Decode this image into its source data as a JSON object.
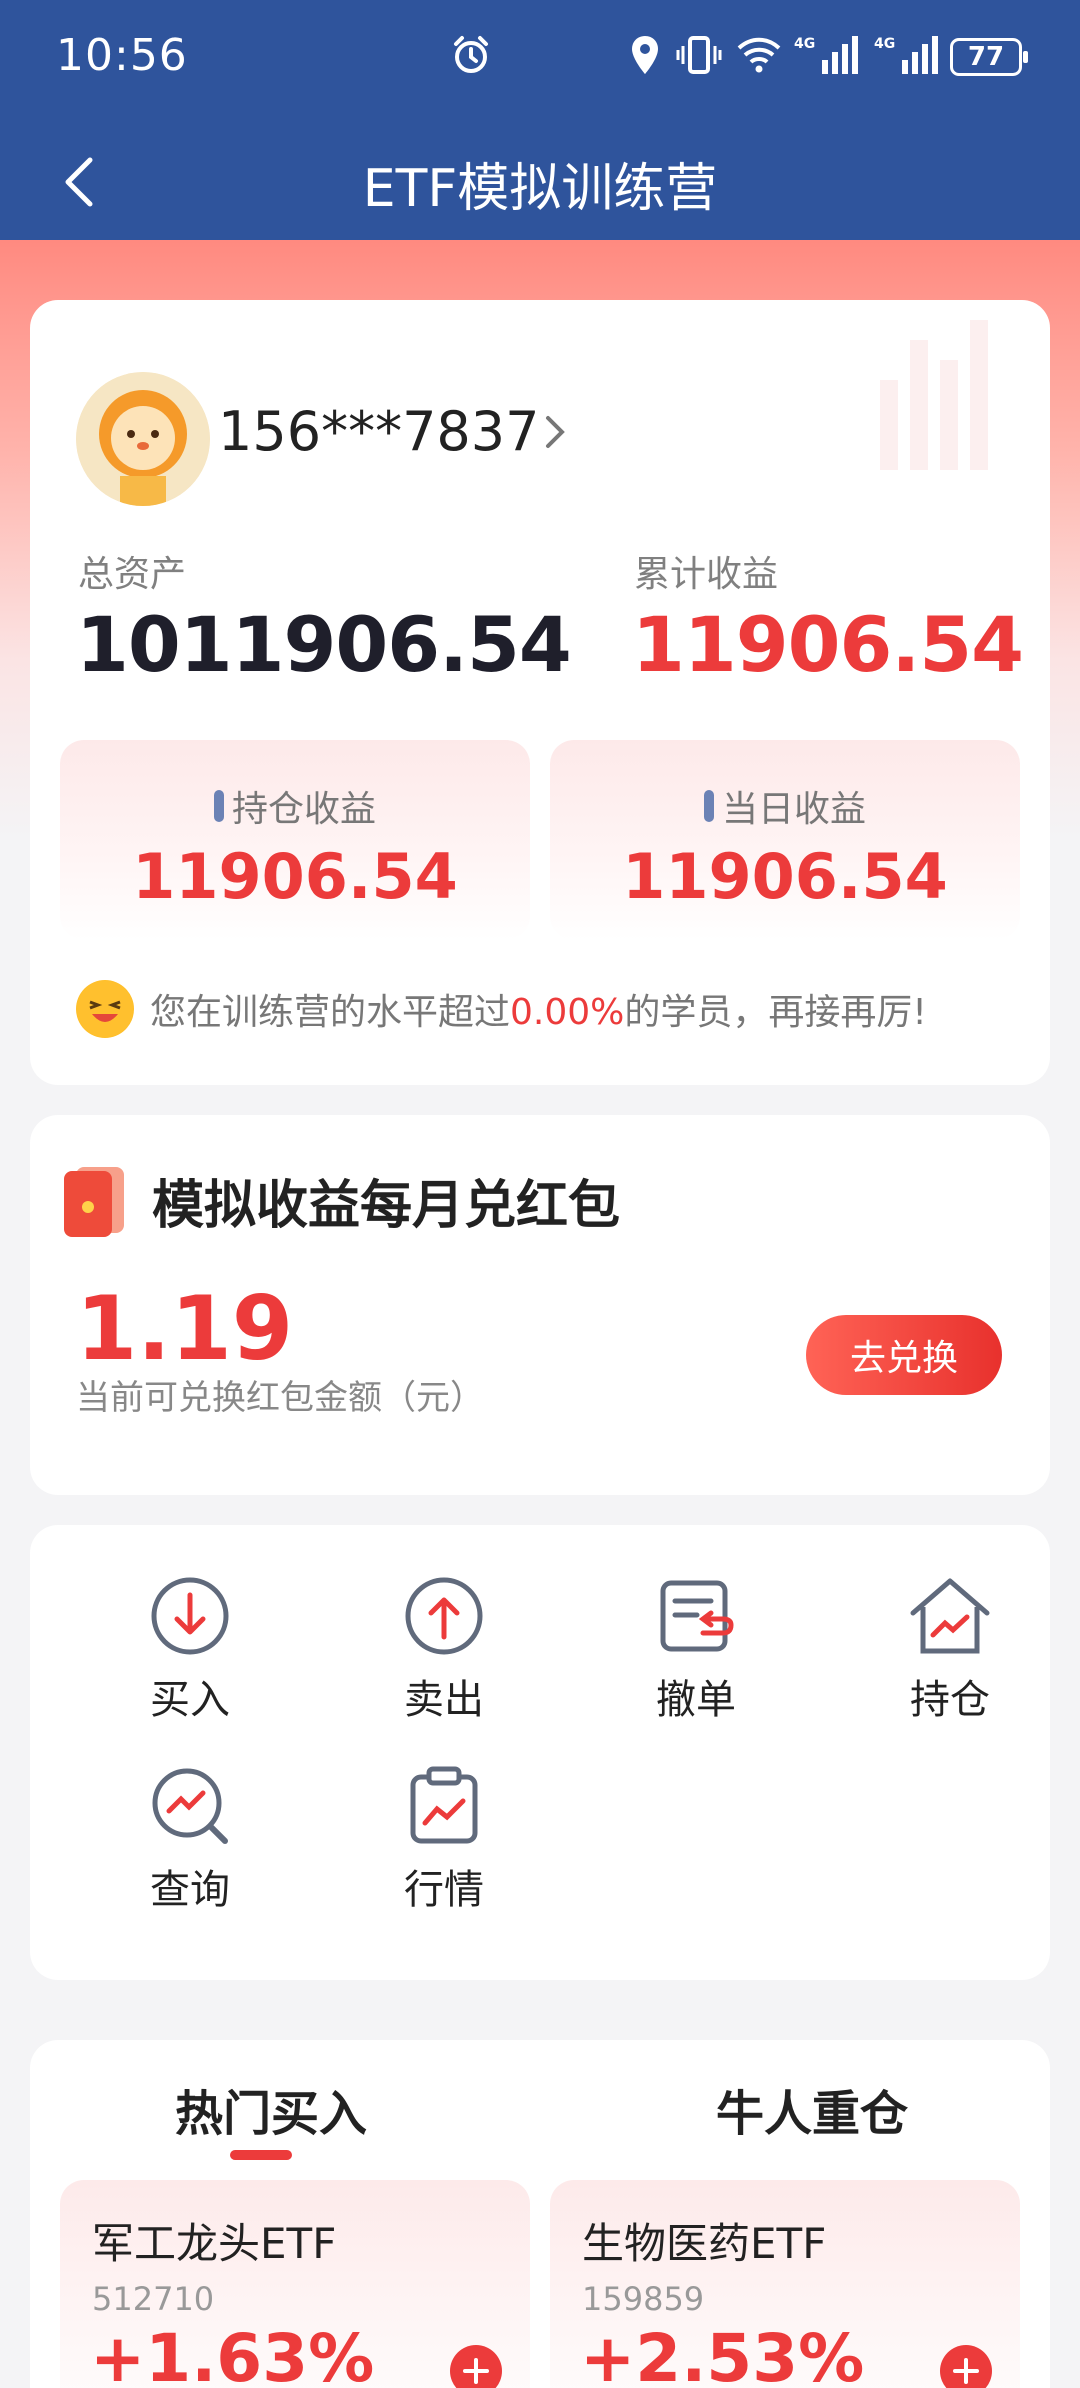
{
  "status_bar": {
    "time": "10:56",
    "battery": "77",
    "icons": [
      "alarm-icon",
      "location-icon",
      "vibrate-icon",
      "wifi-icon",
      "signal-4g-icon",
      "signal-4g-icon-2"
    ]
  },
  "header": {
    "title": "ETF模拟训练营",
    "back_icon": "chevron-left-icon"
  },
  "account": {
    "user_id": "156***7837",
    "total_assets_label": "总资产",
    "total_assets": "1011906.54",
    "cumulative_label": "累计收益",
    "cumulative": "11906.54",
    "position_label": "持仓收益",
    "position_value": "11906.54",
    "daily_label": "当日收益",
    "daily_value": "11906.54",
    "level_prefix": "您在训练营的水平超过",
    "level_percent": "0.00%",
    "level_suffix": "的学员，再接再厉!"
  },
  "red_packet": {
    "title": "模拟收益每月兑红包",
    "amount": "1.19",
    "desc": "当前可兑换红包金额（元）",
    "button": "去兑换"
  },
  "actions": [
    {
      "label": "买入",
      "icon": "buy-arrow-down-icon"
    },
    {
      "label": "卖出",
      "icon": "sell-arrow-up-icon"
    },
    {
      "label": "撤单",
      "icon": "cancel-order-icon"
    },
    {
      "label": "持仓",
      "icon": "holdings-house-icon"
    },
    {
      "label": "查询",
      "icon": "query-search-icon"
    },
    {
      "label": "行情",
      "icon": "market-clipboard-icon"
    }
  ],
  "hot": {
    "tabs": [
      "热门买入",
      "牛人重仓"
    ],
    "items": [
      {
        "name": "军工龙头ETF",
        "code": "512710",
        "change": "+1.63%"
      },
      {
        "name": "生物医药ETF",
        "code": "159859",
        "change": "+2.53%"
      }
    ]
  },
  "colors": {
    "header": "#2f549c",
    "accent": "#ec3b3b"
  }
}
